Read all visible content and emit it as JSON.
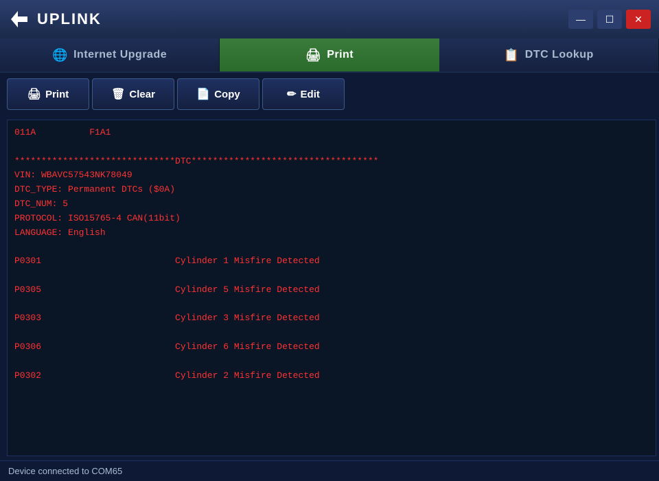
{
  "titleBar": {
    "logoText": "UPLINK",
    "minLabel": "—",
    "maxLabel": "☐",
    "closeLabel": "✕"
  },
  "tabs": [
    {
      "id": "internet-upgrade",
      "label": "Internet Upgrade",
      "icon": "🌐",
      "active": false
    },
    {
      "id": "print",
      "label": "Print",
      "icon": "🖨",
      "active": true
    },
    {
      "id": "dtc-lookup",
      "label": "DTC Lookup",
      "icon": "📋",
      "active": false
    }
  ],
  "toolbar": {
    "printLabel": "Print",
    "clearLabel": "Clear",
    "copyLabel": "Copy",
    "editLabel": "Edit"
  },
  "content": {
    "lines": [
      "011A          F1A1",
      "",
      "******************************DTC***********************************",
      "VIN: WBAVC57543NK78049",
      "DTC_TYPE: Permanent DTCs ($0A)",
      "DTC_NUM: 5",
      "PROTOCOL: ISO15765-4 CAN(11bit)",
      "LANGUAGE: English",
      "",
      "P0301                         Cylinder 1 Misfire Detected",
      "",
      "P0305                         Cylinder 5 Misfire Detected",
      "",
      "P0303                         Cylinder 3 Misfire Detected",
      "",
      "P0306                         Cylinder 6 Misfire Detected",
      "",
      "P0302                         Cylinder 2 Misfire Detected"
    ]
  },
  "statusBar": {
    "text": "Device connected to COM65"
  }
}
